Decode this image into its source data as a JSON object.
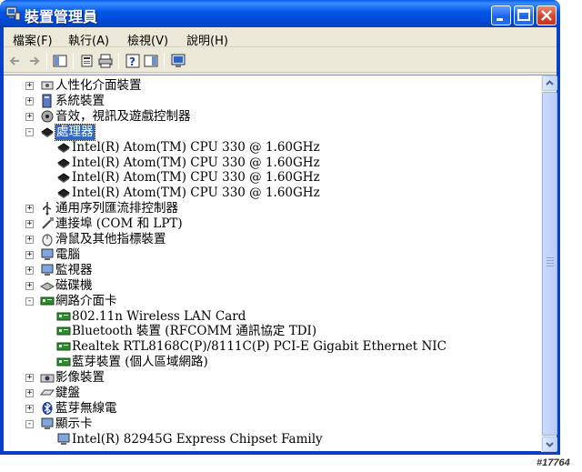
{
  "window": {
    "title": "裝置管理員",
    "controls": {
      "minimize": "minimize",
      "maximize": "maximize",
      "close": "close"
    }
  },
  "menu": [
    {
      "label": "檔案(F)"
    },
    {
      "label": "執行(A)"
    },
    {
      "label": "檢視(V)"
    },
    {
      "label": "說明(H)"
    }
  ],
  "toolbar": [
    "back-icon",
    "forward-icon",
    "view-icon",
    "properties-icon",
    "print-icon",
    "help-icon",
    "view2-icon",
    "scan-hardware-icon"
  ],
  "tree": [
    {
      "label": "人性化介面裝置",
      "expander": "+",
      "icon": "hid-icon",
      "level": 1
    },
    {
      "label": "系統裝置",
      "expander": "+",
      "icon": "system-icon",
      "level": 1
    },
    {
      "label": "音效，視訊及遊戲控制器",
      "expander": "+",
      "icon": "sound-icon",
      "level": 1
    },
    {
      "label": "處理器",
      "expander": "-",
      "icon": "processor-icon",
      "level": 1,
      "selected": true
    },
    {
      "label": "Intel(R) Atom(TM) CPU  330   @ 1.60GHz",
      "icon": "processor-icon",
      "level": 2
    },
    {
      "label": "Intel(R) Atom(TM) CPU  330   @ 1.60GHz",
      "icon": "processor-icon",
      "level": 2
    },
    {
      "label": "Intel(R) Atom(TM) CPU  330   @ 1.60GHz",
      "icon": "processor-icon",
      "level": 2
    },
    {
      "label": "Intel(R) Atom(TM) CPU  330   @ 1.60GHz",
      "icon": "processor-icon",
      "level": 2
    },
    {
      "label": "通用序列匯流排控制器",
      "expander": "+",
      "icon": "usb-icon",
      "level": 1
    },
    {
      "label": "連接埠 (COM 和 LPT)",
      "expander": "+",
      "icon": "port-icon",
      "level": 1
    },
    {
      "label": "滑鼠及其他指標裝置",
      "expander": "+",
      "icon": "mouse-icon",
      "level": 1
    },
    {
      "label": "電腦",
      "expander": "+",
      "icon": "computer-icon",
      "level": 1
    },
    {
      "label": "監視器",
      "expander": "+",
      "icon": "monitor-icon",
      "level": 1
    },
    {
      "label": "磁碟機",
      "expander": "+",
      "icon": "disk-icon",
      "level": 1
    },
    {
      "label": "網路介面卡",
      "expander": "-",
      "icon": "network-card-icon",
      "level": 1
    },
    {
      "label": "802.11n Wireless LAN Card",
      "icon": "network-card-icon",
      "level": 2
    },
    {
      "label": "Bluetooth 裝置 (RFCOMM 通訊協定 TDI)",
      "icon": "network-card-icon",
      "level": 2
    },
    {
      "label": "Realtek RTL8168C(P)/8111C(P) PCI-E Gigabit Ethernet NIC",
      "icon": "network-card-icon",
      "level": 2
    },
    {
      "label": "藍芽裝置 (個人區域網路)",
      "icon": "network-card-icon",
      "level": 2
    },
    {
      "label": "影像裝置",
      "expander": "+",
      "icon": "imaging-icon",
      "level": 1
    },
    {
      "label": "鍵盤",
      "expander": "+",
      "icon": "keyboard-icon",
      "level": 1
    },
    {
      "label": "藍芽無線電",
      "expander": "+",
      "icon": "bluetooth-icon",
      "level": 1
    },
    {
      "label": "顯示卡",
      "expander": "-",
      "icon": "display-icon",
      "level": 1
    },
    {
      "label": "Intel(R) 82945G Express Chipset Family",
      "icon": "display-icon",
      "level": 2
    }
  ],
  "watermark": "#17764",
  "colors": {
    "titlebar": "#0055e5",
    "selection": "#316ac5",
    "menubar": "#ece9d8"
  }
}
